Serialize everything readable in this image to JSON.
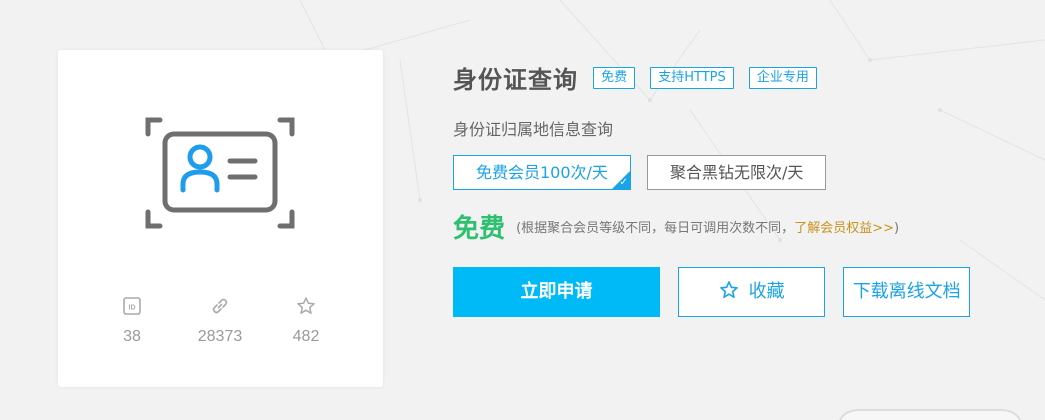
{
  "colors": {
    "accent": "#1aa3e8",
    "primary_button": "#00b9f7",
    "price_green": "#2fbf71",
    "link_gold": "#c8931d",
    "icon_blue": "#1f9ded",
    "icon_gray": "#6f6f6f"
  },
  "card": {
    "icon": "id-card-icon",
    "stats": [
      {
        "icon": "id-badge-icon",
        "value": "38"
      },
      {
        "icon": "link-icon",
        "value": "28373"
      },
      {
        "icon": "star-icon",
        "value": "482"
      }
    ]
  },
  "api": {
    "title": "身份证查询",
    "tags": [
      "免费",
      "支持HTTPS",
      "企业专用"
    ],
    "subtitle": "身份证归属地信息查询"
  },
  "plans": [
    {
      "label": "免费会员100次/天",
      "selected": true
    },
    {
      "label": "聚合黑钻无限次/天",
      "selected": false
    }
  ],
  "pricing": {
    "price": "免费",
    "note_prefix": "(根据聚合会员等级不同，每日可调用次数不同，",
    "note_link": "了解会员权益>>",
    "note_suffix": ")"
  },
  "actions": {
    "apply_label": "立即申请",
    "favorite_label": "收藏",
    "download_label": "下载离线文档"
  }
}
